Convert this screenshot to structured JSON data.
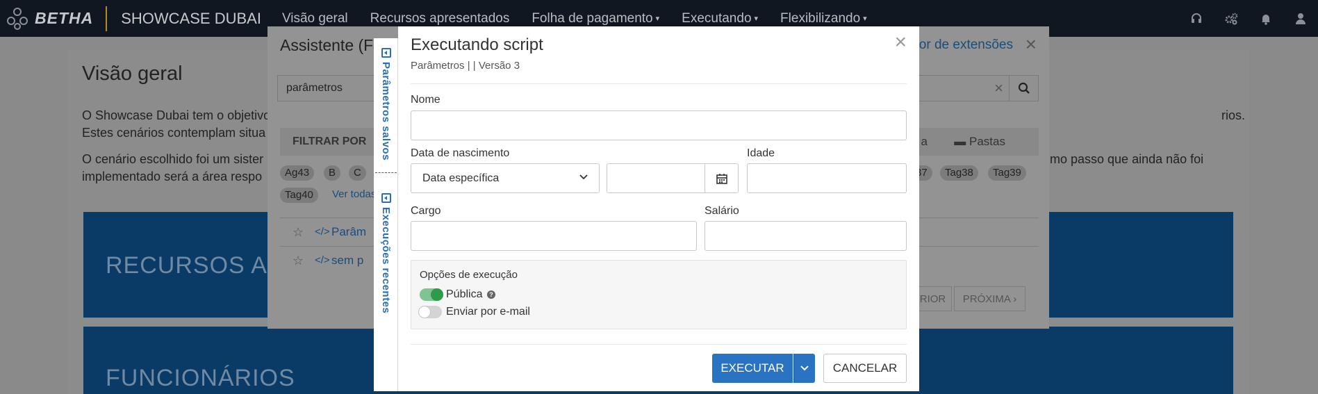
{
  "navbar": {
    "brand": "BETHA",
    "app_name": "SHOWCASE DUBAI",
    "items": [
      {
        "label": "Visão geral"
      },
      {
        "label": "Recursos apresentados"
      },
      {
        "label": "Folha de pagamento",
        "caret": "⌄"
      },
      {
        "label": "Executando",
        "caret": "⌄"
      },
      {
        "label": "Flexibilizando",
        "caret": "⌄"
      }
    ],
    "icons": [
      "headset-icon",
      "gears-icon",
      "bell-icon",
      "user-icon"
    ]
  },
  "page": {
    "title": "Visão geral",
    "text1a": "O Showcase Dubai tem o objetivo",
    "text1b": "rios.",
    "text2": "Estes cenários contemplam situa",
    "text3a": "O cenário escolhido foi um sister",
    "text3b": "ximo passo que ainda não foi",
    "text4": "implementado será a área respo",
    "card1_title": "RECURSOS APR",
    "card2_title": "FUNCIONÁRIOS"
  },
  "assistant": {
    "title": "Assistente (F4",
    "link": "dor de extensões",
    "close": "×",
    "search_value": "parâmetros",
    "clear": "×",
    "filter_label": "FILTRAR POR",
    "filter_ia": "a",
    "filter_pastas": "Pastas",
    "tags_left": [
      "Ag43",
      "B",
      "C"
    ],
    "tags_right": [
      "37",
      "Tag38",
      "Tag39"
    ],
    "tag_row2": "Tag40",
    "see_all": "Ver todas",
    "rows": [
      {
        "name": "Parâm"
      },
      {
        "name": "sem p"
      }
    ],
    "prev": "RIOR",
    "next": "PRÓXIMA ›"
  },
  "side_tabs": {
    "saved": "Parâmetros salvos",
    "recent": "Execuções recentes"
  },
  "modal": {
    "title": "Executando script",
    "subtitle": "Parâmetros | | Versão 3",
    "close": "×",
    "nome_label": "Nome",
    "nome_value": "",
    "nascimento_label": "Data de nascimento",
    "nascimento_mode": "Data específica",
    "nascimento_value": "",
    "idade_label": "Idade",
    "idade_value": "",
    "cargo_label": "Cargo",
    "cargo_value": "",
    "salario_label": "Salário",
    "salario_value": "",
    "options_title": "Opções de execução",
    "opt_public": "Pública",
    "opt_public_on": true,
    "opt_email": "Enviar por e-mail",
    "opt_email_on": false,
    "execute_label": "EXECUTAR",
    "cancel_label": "CANCELAR"
  },
  "colors": {
    "navbar_bg": "#101720",
    "primary": "#2a72c2",
    "toggle_on": "#2c9c4a",
    "brand_divider": "#b98a1f"
  }
}
